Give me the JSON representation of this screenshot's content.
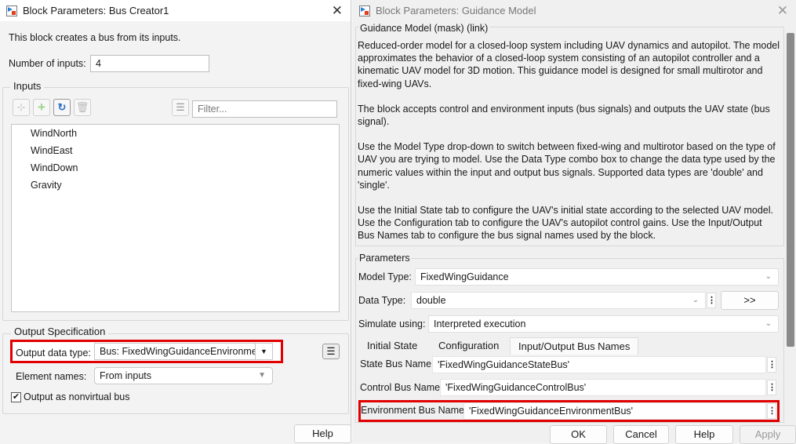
{
  "bus_creator": {
    "title": "Block Parameters: Bus Creator1",
    "description": "This block creates a bus from its inputs.",
    "num_inputs_label": "Number of inputs:",
    "num_inputs_value": "4",
    "inputs_group": "Inputs",
    "filter_placeholder": "Filter...",
    "inputs": [
      "WindNorth",
      "WindEast",
      "WindDown",
      "Gravity"
    ],
    "output_group": "Output Specification",
    "output_type_label": "Output data type:",
    "output_type_value": "Bus: FixedWingGuidanceEnvironmer",
    "element_names_label": "Element names:",
    "element_names_value": "From inputs",
    "nonvirtual_label": "Output as nonvirtual bus",
    "nonvirtual_checked": true,
    "help": "Help"
  },
  "guidance": {
    "title": "Block Parameters: Guidance Model",
    "mask_header": "Guidance Model (mask) (link)",
    "paragraphs": [
      "Reduced-order model for a closed-loop system including UAV dynamics and autopilot. The model approximates the behavior of a closed-loop system consisting of an autopilot controller and a kinematic UAV model for 3D motion. This guidance model is designed for small multirotor and fixed-wing UAVs.",
      "The block accepts control and environment inputs (bus signals) and outputs the UAV state (bus signal).",
      "Use the Model Type drop-down to switch between fixed-wing and multirotor based on the type of UAV you are trying to model. Use the Data Type combo box to change the data type used by the numeric values within the input and output bus signals. Supported data types are 'double' and 'single'.",
      "Use the Initial State tab to configure the UAV's initial state according to the selected UAV model. Use the Configuration tab to configure the UAV's autopilot control gains. Use the Input/Output Bus Names tab to configure the bus signal names used by the block."
    ],
    "parameters": "Parameters",
    "model_type_label": "Model Type:",
    "model_type_value": "FixedWingGuidance",
    "data_type_label": "Data Type:",
    "data_type_value": "double",
    "expand_button": ">>",
    "simulate_label": "Simulate using:",
    "simulate_value": "Interpreted execution",
    "tabs": [
      "Initial State",
      "Configuration",
      "Input/Output Bus Names"
    ],
    "active_tab": "Input/Output Bus Names",
    "state_bus_label": "State Bus Name",
    "state_bus_value": "'FixedWingGuidanceStateBus'",
    "control_bus_label": "Control Bus Name",
    "control_bus_value": "'FixedWingGuidanceControlBus'",
    "env_bus_label": "Environment Bus Name",
    "env_bus_value": "'FixedWingGuidanceEnvironmentBus'",
    "ok": "OK",
    "cancel": "Cancel",
    "help": "Help",
    "apply": "Apply"
  },
  "colors": {
    "highlight": "#e00000"
  }
}
